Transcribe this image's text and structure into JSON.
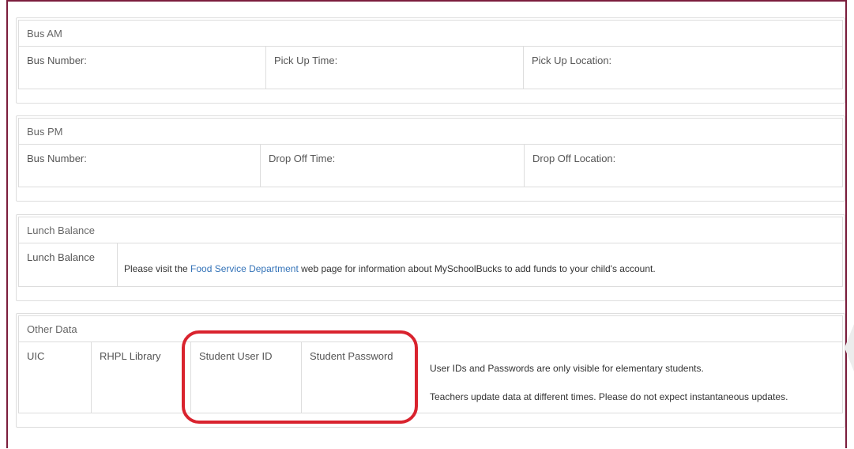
{
  "bus_am": {
    "title": "Bus AM",
    "bus_number_label": "Bus Number:",
    "pickup_time_label": "Pick Up Time:",
    "pickup_location_label": "Pick Up Location:"
  },
  "bus_pm": {
    "title": "Bus PM",
    "bus_number_label": "Bus Number:",
    "dropoff_time_label": "Drop Off Time:",
    "dropoff_location_label": "Drop Off Location:"
  },
  "lunch": {
    "title": "Lunch Balance",
    "row_label": "Lunch Balance",
    "text_before": "Please visit the ",
    "link_text": "Food Service Department",
    "text_after": " web page for information about MySchoolBucks to add funds to your child's account."
  },
  "other": {
    "title": "Other Data",
    "col_uic": "UIC",
    "col_library": "RHPL Library",
    "col_user_id": "Student  User ID",
    "col_password": "Student  Password",
    "note1": "User IDs and Passwords are only visible for elementary students.",
    "note2": "Teachers update data at different times. Please do not expect instantaneous updates."
  },
  "colors": {
    "frame_border": "#7b1d3c",
    "highlight": "#d9232e",
    "link": "#3473b8"
  }
}
